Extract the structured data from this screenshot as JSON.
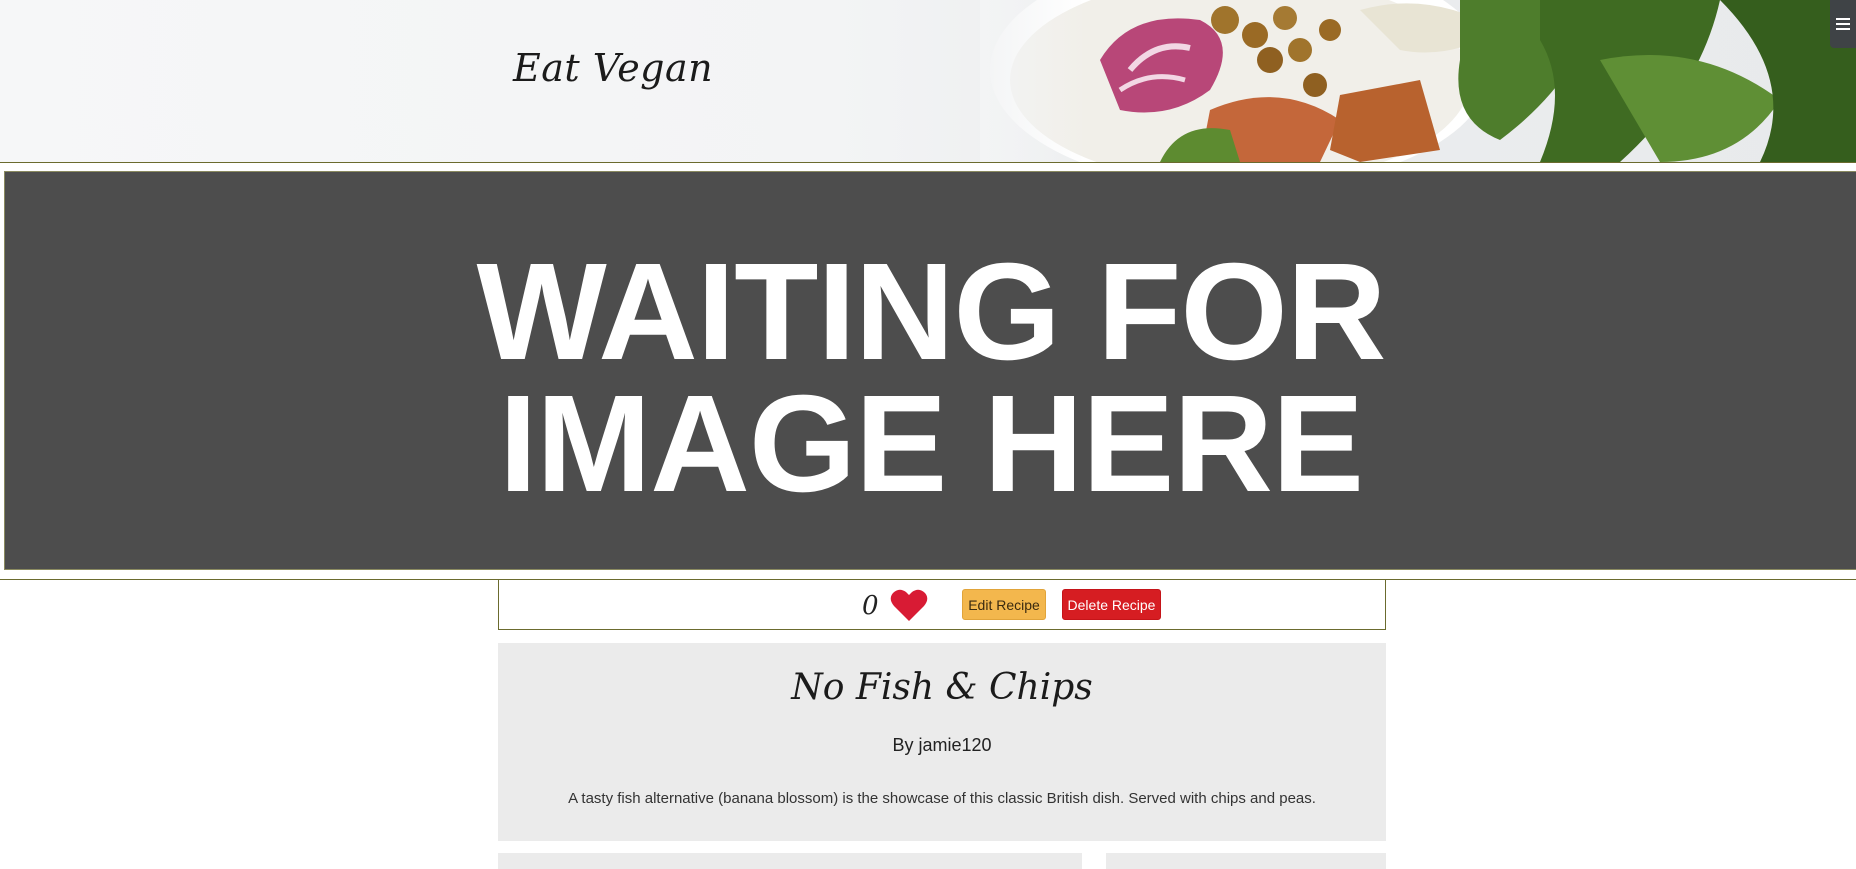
{
  "header": {
    "brand": "Eat Vegan",
    "menu_icon": "hamburger-icon"
  },
  "hero": {
    "placeholder_line1": "WAITING FOR",
    "placeholder_line2": "IMAGE HERE"
  },
  "actions": {
    "likes_count": "0",
    "like_icon": "heart-icon",
    "edit_label": "Edit Recipe",
    "delete_label": "Delete Recipe"
  },
  "recipe": {
    "title": "No Fish & Chips",
    "author": "By jamie120",
    "description": "A tasty fish alternative (banana blossom) is the showcase of this classic British dish. Served with chips and peas."
  },
  "colors": {
    "accent_rule": "#6b6b2e",
    "edit_button": "#f3b74d",
    "delete_button": "#d61d22",
    "heart": "#d81b34",
    "hero_bg": "#4d4d4d",
    "card_bg": "#ebebeb"
  }
}
